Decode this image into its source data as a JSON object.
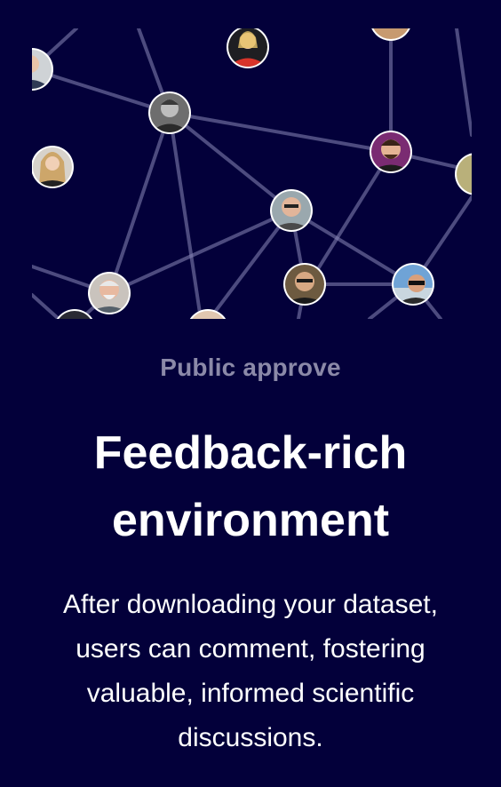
{
  "section": {
    "eyebrow": "Public approve",
    "heading": "Feedback-rich environment",
    "body": "After downloading your dataset, users can comment, fostering valuable, informed scientific discussions."
  },
  "colors": {
    "background": "#03003a",
    "eyebrow": "#8b89a8",
    "text": "#ffffff",
    "connector": "#8a88b8"
  },
  "network": {
    "avatars": [
      "user-avatar",
      "user-avatar",
      "user-avatar",
      "user-avatar",
      "user-avatar",
      "user-avatar",
      "user-avatar",
      "user-avatar",
      "user-avatar",
      "user-avatar",
      "user-avatar",
      "user-avatar",
      "user-avatar",
      "user-avatar"
    ]
  }
}
